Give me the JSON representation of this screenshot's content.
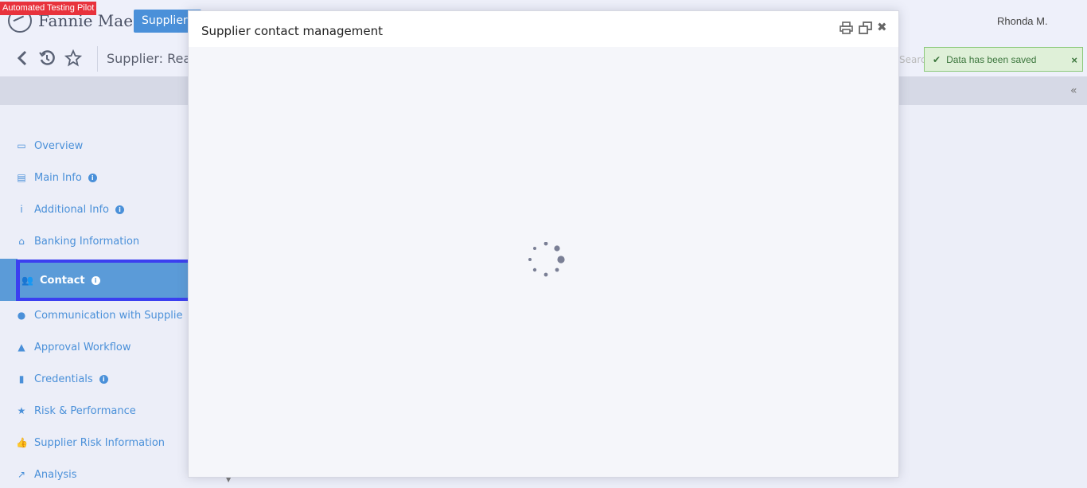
{
  "banner": {
    "label": "Automated Testing Pilot"
  },
  "header": {
    "logo_text": "Fannie Mae",
    "trademark": "™",
    "module_button": "Suppliers",
    "user": "Rhonda M."
  },
  "toolbar": {
    "supplier_title": "Supplier: Rea",
    "search_placeholder": "Searc"
  },
  "toast": {
    "message": "Data has been saved",
    "close": "×"
  },
  "sidebar": {
    "items": [
      {
        "label": "Overview"
      },
      {
        "label": "Main Info"
      },
      {
        "label": "Additional Info"
      },
      {
        "label": "Banking Information"
      },
      {
        "label": "Contact"
      },
      {
        "label": "Communication with Supplie"
      },
      {
        "label": "Approval Workflow"
      },
      {
        "label": "Credentials"
      },
      {
        "label": "Risk & Performance"
      },
      {
        "label": "Supplier Risk Information"
      },
      {
        "label": "Analysis"
      }
    ]
  },
  "modal": {
    "title": "Supplier contact management",
    "close": "✖"
  },
  "colors": {
    "accent": "#4a90d9",
    "active_item": "#5b9bd8",
    "active_border": "#3b3ff0",
    "toast_bg": "#dff0d8",
    "badge": "#e8323c"
  },
  "icons": [
    "back-icon",
    "history-icon",
    "star-icon",
    "printer-icon",
    "restore-window-icon",
    "close-icon",
    "spinner-icon",
    "check-icon",
    "double-chevron-left-icon"
  ]
}
